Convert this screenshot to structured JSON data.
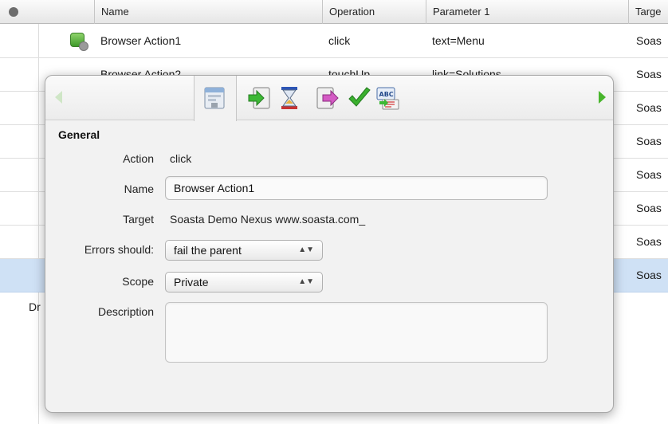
{
  "table": {
    "columns": [
      "Name",
      "Operation",
      "Parameter 1",
      "Targe"
    ],
    "rows": [
      {
        "name": "Browser Action1",
        "operation": "click",
        "parameter1": "text=Menu",
        "target": "Soas"
      },
      {
        "name": "Browser Action2",
        "operation": "touchUp",
        "parameter1": "link=Solutions",
        "target": "Soas"
      },
      {
        "target": "Soas"
      },
      {
        "target": "Soas"
      },
      {
        "target": "Soas"
      },
      {
        "target": "Soas"
      },
      {
        "target": "Soas"
      },
      {
        "target": "Soas"
      }
    ],
    "below_text": "Dr"
  },
  "popover": {
    "toolbar_icons": [
      "properties-icon",
      "input-icon",
      "waits-icon",
      "output-icon",
      "validations-icon",
      "locators-icon"
    ],
    "section": "General",
    "action_label": "Action",
    "action_value": "click",
    "name_label": "Name",
    "name_value": "Browser Action1",
    "target_label": "Target",
    "target_value": "Soasta Demo Nexus www.soasta.com_",
    "errors_label": "Errors should:",
    "errors_value": "fail the parent",
    "scope_label": "Scope",
    "scope_value": "Private",
    "description_label": "Description",
    "description_value": ""
  },
  "colors": {
    "selected_row": "#cfe1f5",
    "nav_arrow": "#48b52c"
  }
}
